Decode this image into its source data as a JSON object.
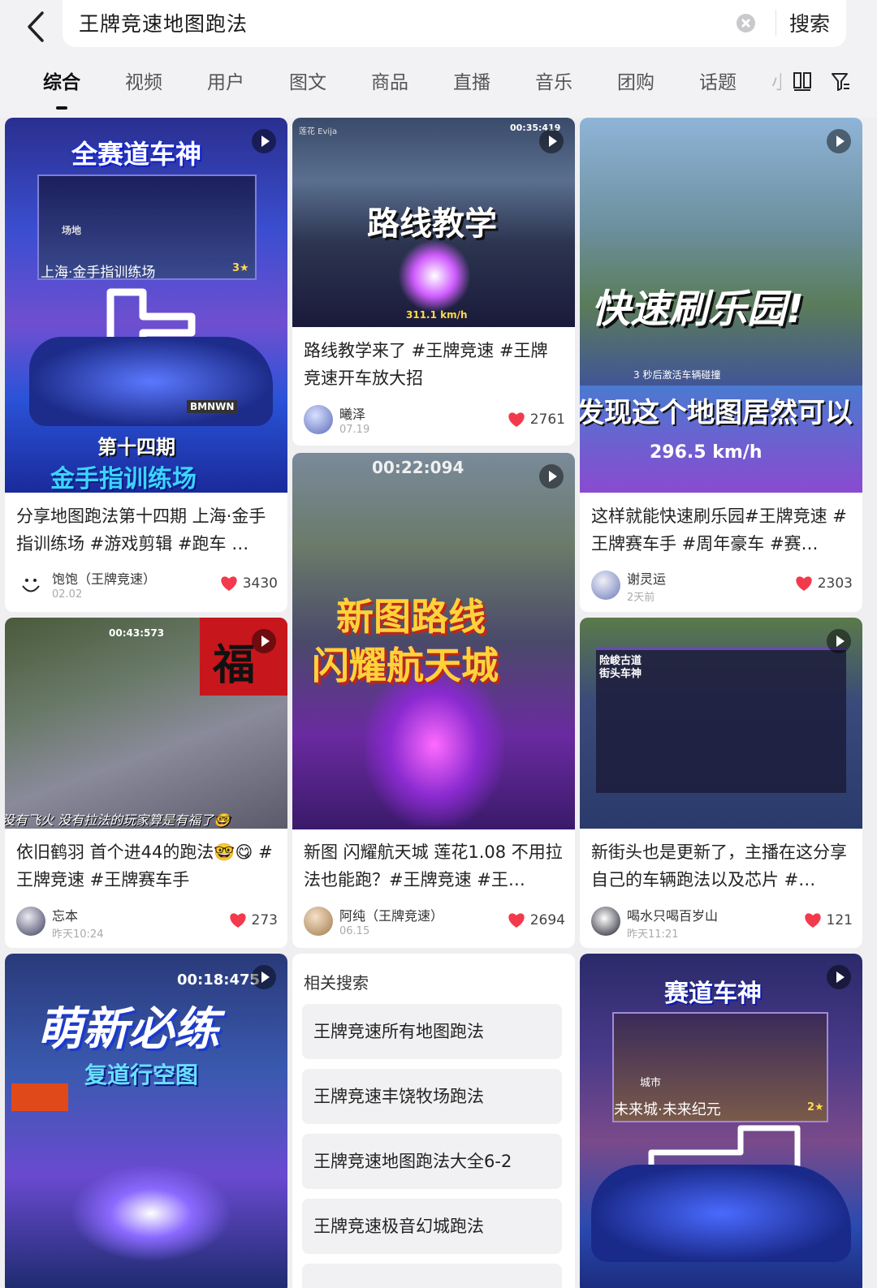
{
  "search": {
    "query": "王牌竞速地图跑法",
    "button": "搜索"
  },
  "tabs": [
    "综合",
    "视频",
    "用户",
    "图文",
    "商品",
    "直播",
    "音乐",
    "团购",
    "话题",
    "小"
  ],
  "cards": [
    {
      "overlay_top": "全赛道车神",
      "overlay_location": "上海·金手指训练场",
      "overlay_location_tag": "场地",
      "overlay_stars": "3★",
      "overlay_plate": "BMNWN",
      "overlay_episode": "第十四期",
      "overlay_bottom": "金手指训练场",
      "title": "分享地图跑法第十四期 上海·金手指训练场 #游戏剪辑 #跑车 …",
      "author": "饱饱（王牌竞速）",
      "date": "02.02",
      "likes": "3430"
    },
    {
      "overlay_top": "路线教学",
      "overlay_speed": "311.1 km/h",
      "overlay_timer": "00:35:419",
      "overlay_user": "莲花 Evija",
      "title": "路线教学来了 #王牌竞速 #王牌竞速开车放大招",
      "author": "曦泽",
      "date": "07.19",
      "likes": "2761"
    },
    {
      "overlay_top": "快速刷乐园!",
      "overlay_hint": "3 秒后激活车辆碰撞",
      "overlay_mid": "发现这个地图居然可以",
      "overlay_speed": "296.5 km/h",
      "title": "这样就能快速刷乐园#王牌竞速 #王牌赛车手 #周年豪车 #赛…",
      "author": "谢灵运",
      "date": "2天前",
      "likes": "2303"
    },
    {
      "overlay_timer": "00:43:573",
      "overlay_fu": "福",
      "overlay_bottom": "没有飞火 没有拉法的玩家算是有福了🤓",
      "title": "依旧鹤羽 首个进44的跑法🤓😋 #王牌竞速 #王牌赛车手",
      "author": "忘本",
      "date": "昨天10:24",
      "likes": "273"
    },
    {
      "overlay_timer": "00:22:094",
      "overlay_line1": "新图路线",
      "overlay_line2": "闪耀航天城",
      "title": "新图 闪耀航天城 莲花1.08 不用拉法也能跑？#王牌竞速 #王…",
      "author": "阿纯（王牌竞速）",
      "date": "06.15",
      "likes": "2694"
    },
    {
      "overlay_panel1": "险峻古道",
      "overlay_panel2": "街头车神",
      "title": "新街头也是更新了，主播在这分享自己的车辆跑法以及芯片 #…",
      "author": "喝水只喝百岁山",
      "date": "昨天11:21",
      "likes": "121"
    },
    {
      "overlay_timer": "00:18:475",
      "overlay_top": "萌新必练",
      "overlay_sub": "复道行空图"
    },
    {
      "overlay_top": "赛道车神",
      "overlay_tag": "城市",
      "overlay_location": "未来城·未来纪元",
      "overlay_stars": "2★"
    }
  ],
  "related": {
    "heading": "相关搜索",
    "items": [
      "王牌竞速所有地图跑法",
      "王牌竞速丰饶牧场跑法",
      "王牌竞速地图跑法大全6-2",
      "王牌竞速极音幻城跑法"
    ]
  },
  "icons": [
    "back-arrow-icon",
    "clear-icon",
    "layout-icon",
    "filter-icon",
    "play-icon",
    "heart-icon"
  ],
  "colors": {
    "heart": "#f23a4c",
    "page_bg": "#efeff1",
    "card_bg": "#ffffff",
    "chip_bg": "#f1f1f3"
  }
}
